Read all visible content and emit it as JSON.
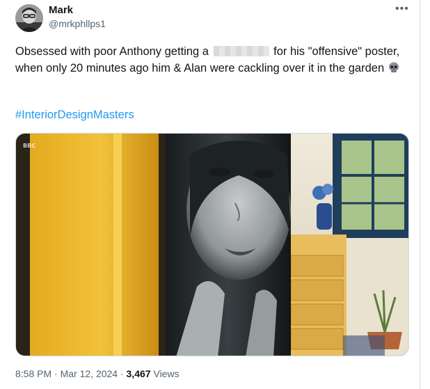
{
  "user": {
    "name": "Mark",
    "handle": "@mrkphllps1"
  },
  "more_icon": "more-options-icon",
  "tweet": {
    "text_part1": "Obsessed with poor Anthony getting a",
    "text_part2": "for his \"offensive\" poster, when only 20 minutes ago him & Alan were cackling over it in the garden",
    "emoji": "skull-icon",
    "hashtag": "#InteriorDesignMasters"
  },
  "media": {
    "watermark": "BBC"
  },
  "meta": {
    "time": "8:58 PM",
    "sep1": "·",
    "date": "Mar 12, 2024",
    "sep2": "·",
    "views_count": "3,467",
    "views_label": "Views"
  },
  "colors": {
    "accent": "#1d9bf0",
    "secondary_text": "#536471",
    "border": "#cfd9de"
  }
}
